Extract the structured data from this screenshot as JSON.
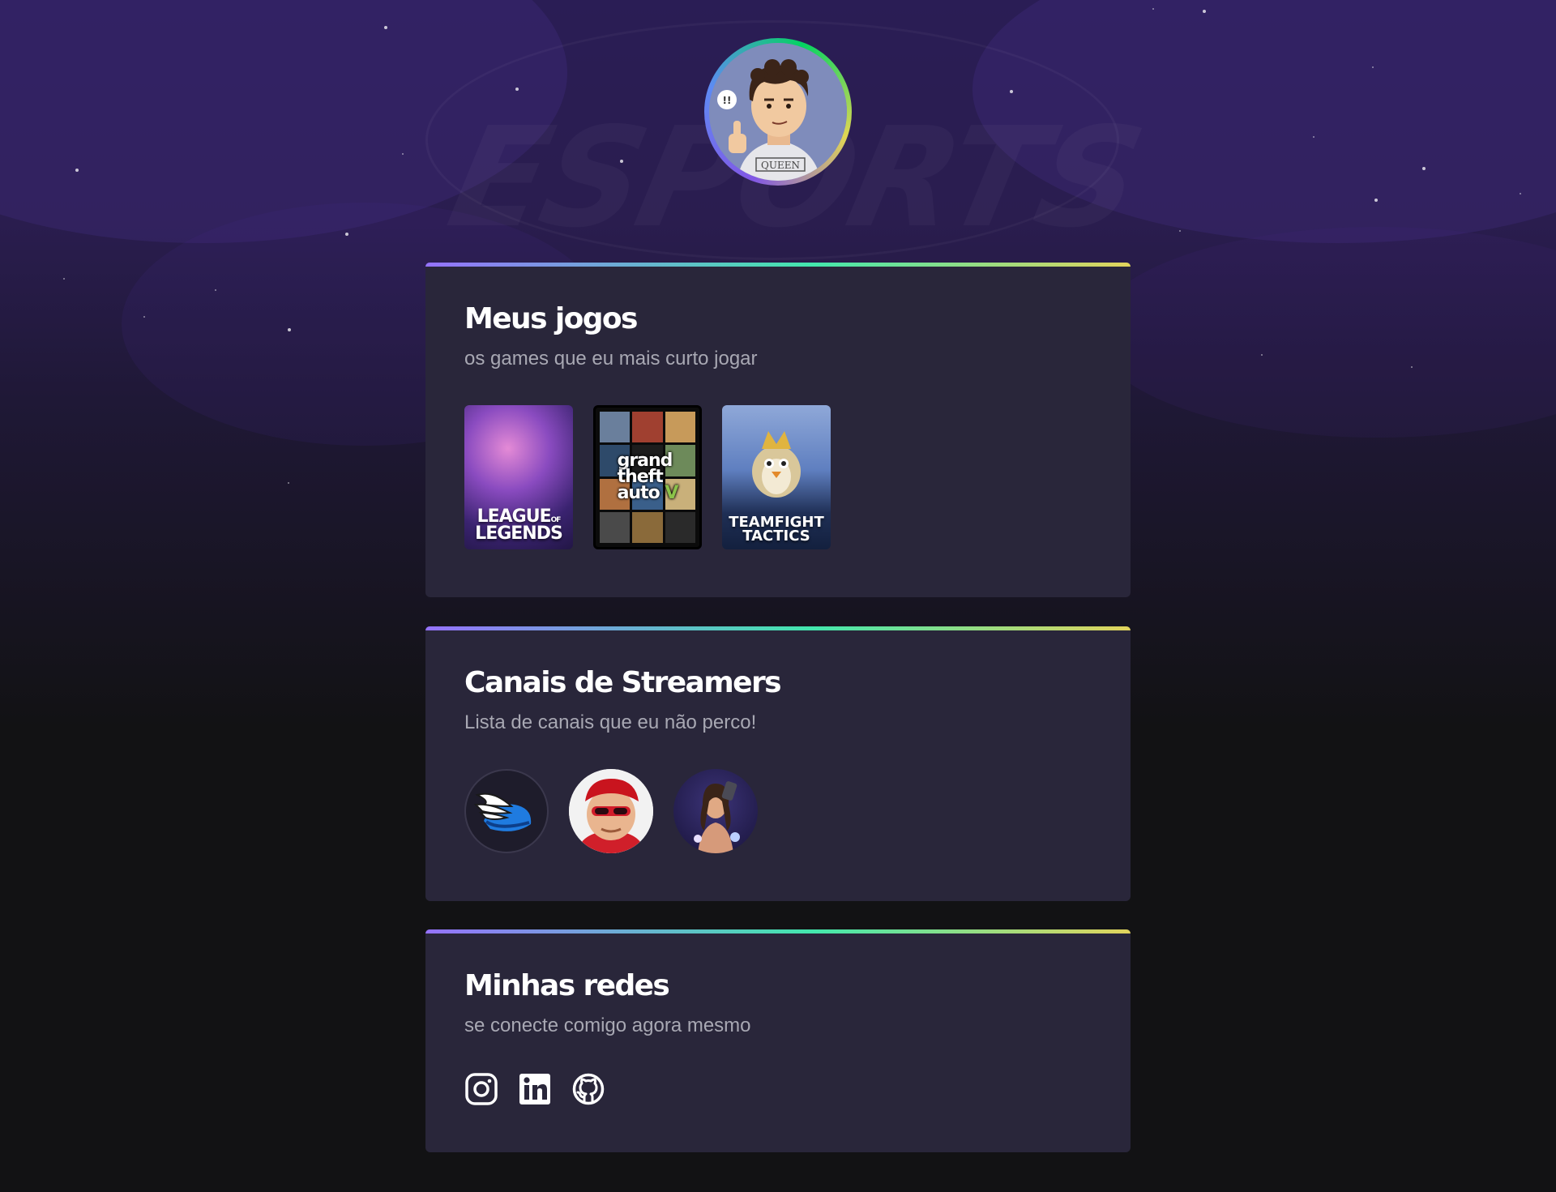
{
  "profile": {
    "avatar_alt": "avatar do usuario",
    "shirt_text": "QUEEN",
    "speech_text": "!!"
  },
  "background": {
    "word": "ESPORTS"
  },
  "games_section": {
    "title": "Meus jogos",
    "subtitle": "os games que eu mais curto jogar",
    "games": [
      {
        "name": "League of Legends",
        "logo_line1": "LEAGUE",
        "logo_of": "OF",
        "logo_line2": "LEGENDS"
      },
      {
        "name": "Grand Theft Auto V",
        "logo_line1": "grand",
        "logo_line2": "theft",
        "logo_line3": "auto",
        "logo_numeral": "V"
      },
      {
        "name": "Teamfight Tactics",
        "logo_line1": "TEAMFIGHT",
        "logo_line2": "TACTICS"
      }
    ]
  },
  "streamers_section": {
    "title": "Canais de Streamers",
    "subtitle": "Lista de canais que eu não perco!",
    "streamers": [
      {
        "icon": "winged-helmet-avatar"
      },
      {
        "icon": "red-cap-streamer-avatar"
      },
      {
        "icon": "warrior-streamer-avatar"
      }
    ]
  },
  "social_section": {
    "title": "Minhas redes",
    "subtitle": "se conecte comigo agora mesmo",
    "links": [
      {
        "icon": "instagram-icon"
      },
      {
        "icon": "linkedin-icon"
      },
      {
        "icon": "github-icon"
      }
    ]
  },
  "colors": {
    "background": "#121214",
    "card": "#29263a",
    "gradient_start": "#9572fc",
    "gradient_mid": "#43e7ad",
    "gradient_end": "#e2d45c",
    "title": "#ffffff",
    "subtitle": "#a8a8b3"
  }
}
